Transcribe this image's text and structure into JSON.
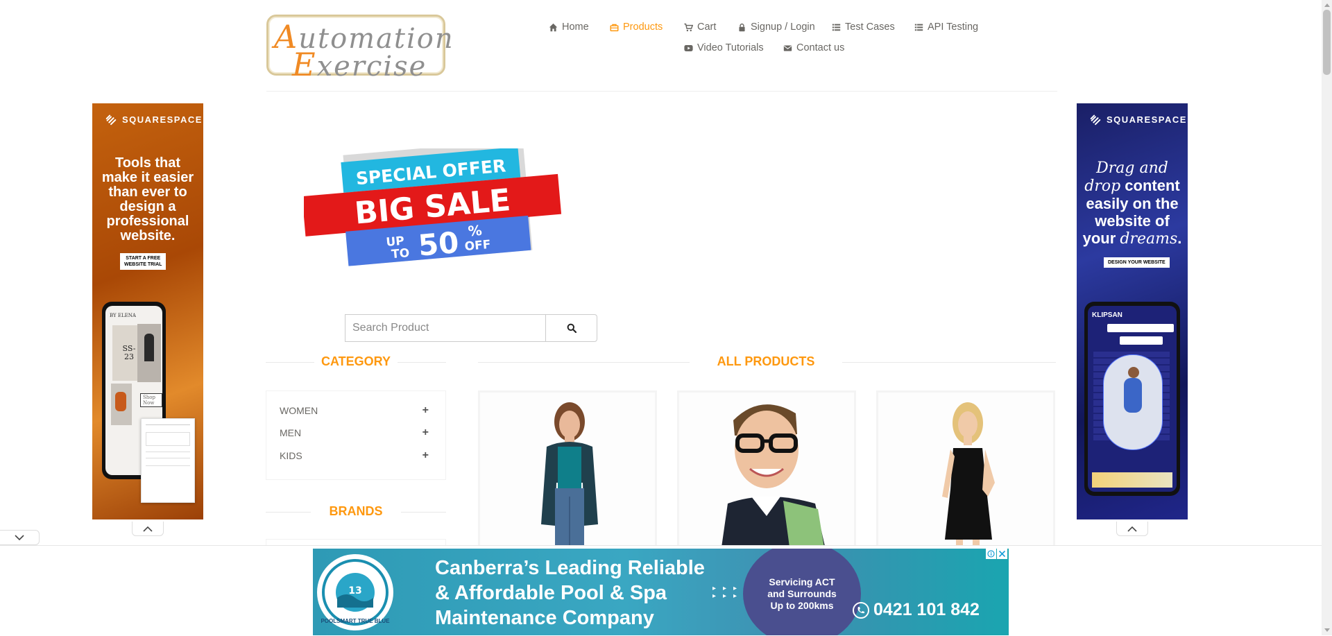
{
  "logo": {
    "line1_cap": "A",
    "line1_rest": "utomation",
    "line2_cap": "E",
    "line2_rest": "xercise"
  },
  "nav": {
    "items": [
      {
        "label": "Home",
        "icon": "home-icon"
      },
      {
        "label": "Products",
        "icon": "shopping-bag-icon",
        "active": true
      },
      {
        "label": "Cart",
        "icon": "cart-icon"
      },
      {
        "label": "Signup / Login",
        "icon": "lock-icon"
      },
      {
        "label": "Test Cases",
        "icon": "list-icon"
      },
      {
        "label": "API Testing",
        "icon": "list-icon"
      },
      {
        "label": "Video Tutorials",
        "icon": "youtube-play-icon"
      },
      {
        "label": "Contact us",
        "icon": "envelope-icon"
      }
    ],
    "active_color": "#fe980f"
  },
  "left_ad": {
    "brand": "SQUARESPACE",
    "copy": "Tools that make it easier than ever to design a professional website.",
    "cta_line1": "START A FREE",
    "cta_line2": "WEBSITE TRIAL",
    "phone_brand": "BY ELENA",
    "phone_text": "SS-23",
    "phone_button": "Shop Now"
  },
  "right_ad": {
    "brand": "SQUARESPACE",
    "copy_drag": "Drag and drop",
    "copy_mid": "content easily on the website of your",
    "copy_dreams": "dreams",
    "cta": "DESIGN YOUR WEBSITE",
    "phone_brand": "KLIPSAN"
  },
  "sale_banner": {
    "line1": "SPECIAL OFFER",
    "line2": "BIG SALE",
    "up": "UP",
    "to": "TO",
    "percent": "50",
    "pct_sign": "%",
    "off": "OFF"
  },
  "search": {
    "placeholder": "Search Product",
    "icon": "search-icon"
  },
  "sidebar": {
    "category_title": "CATEGORY",
    "categories": [
      {
        "label": "WOMEN"
      },
      {
        "label": "MEN"
      },
      {
        "label": "KIDS"
      }
    ],
    "brands_title": "BRANDS"
  },
  "main": {
    "title": "ALL PRODUCTS"
  },
  "bottom_ad": {
    "logo_text": "POOLSMART TRUE BLUE",
    "headline_1": "Canberra’s Leading Reliable",
    "headline_2": "& Affordable Pool & Spa",
    "headline_3": "Maintenance Company",
    "bubble_1": "Servicing ACT",
    "bubble_2": "and Surrounds",
    "bubble_3": "Up to 200kms",
    "phone": "0421 101 842"
  },
  "colors": {
    "accent": "#fe980f",
    "text": "#696763"
  }
}
